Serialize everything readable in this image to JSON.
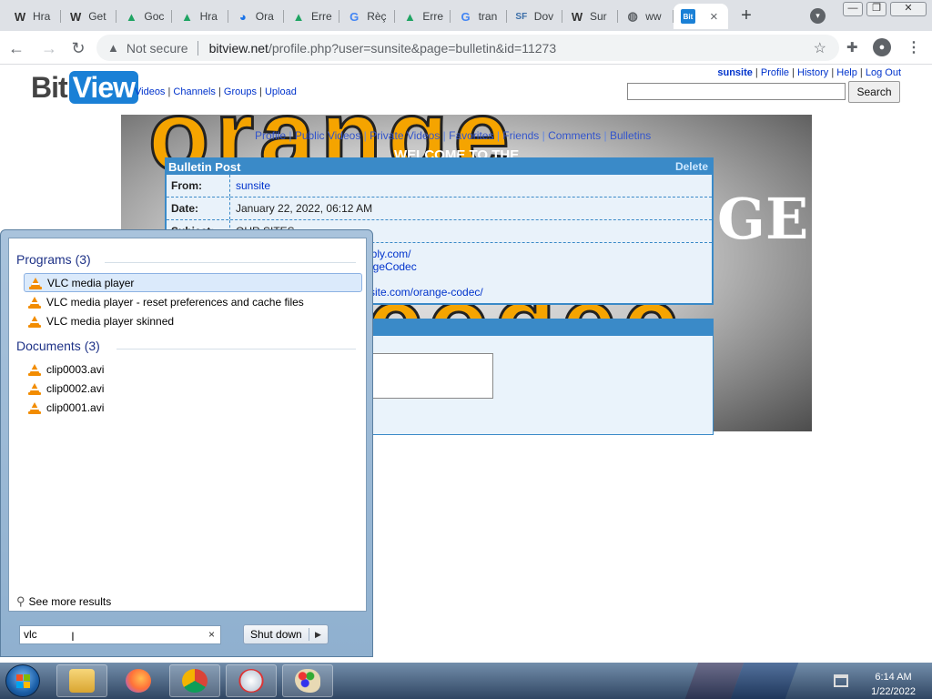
{
  "browser": {
    "tabs": [
      {
        "icon": "W",
        "label": "Hra",
        "color": "#333333"
      },
      {
        "icon": "W",
        "label": "Get",
        "color": "#333333"
      },
      {
        "icon": "▲",
        "label": "Goc",
        "color": "#1fa463"
      },
      {
        "icon": "▲",
        "label": "Hra",
        "color": "#1fa463"
      },
      {
        "icon": "◕",
        "label": "Ora",
        "color": "#1a73e8"
      },
      {
        "icon": "▲",
        "label": "Erre",
        "color": "#1fa463"
      },
      {
        "icon": "G",
        "label": "Rèç",
        "color": "#4285f4"
      },
      {
        "icon": "▲",
        "label": "Erre",
        "color": "#1fa463"
      },
      {
        "icon": "G",
        "label": "tran",
        "color": "#4285f4"
      },
      {
        "icon": "SF",
        "label": "Dov",
        "color": "#3b6ea8"
      },
      {
        "icon": "W",
        "label": "Sur",
        "color": "#333333"
      },
      {
        "icon": "◍",
        "label": "ww",
        "color": "#5f6368"
      }
    ],
    "active_tab": {
      "icon": "Bit",
      "close": "×"
    },
    "new_tab": "+",
    "address": {
      "security_icon": "▲",
      "security": "Not secure",
      "domain": "bitview.net",
      "path": "/profile.php?user=sunsite&page=bulletin&id=11273"
    },
    "window_controls": [
      "—",
      "❐",
      "✕"
    ]
  },
  "site": {
    "logo_bit": "Bit",
    "logo_view": "View",
    "nav": [
      "Videos",
      "Channels",
      "Groups",
      "Upload"
    ],
    "user_links": [
      "sunsite",
      "Profile",
      "History",
      "Help",
      "Log Out"
    ],
    "search_button": "Search",
    "profile_tabs": [
      "Profile",
      "Public Videos",
      "Private Videos",
      "Favorites",
      "Friends",
      "Comments",
      "Bulletins"
    ],
    "banner_welcome": "WELCOME TO THE",
    "banner_word1": "orange",
    "banner_word2": "codec",
    "banner_ge": "GE",
    "bulletin": {
      "title": "Bulletin Post",
      "delete": "Delete",
      "from_label": "From:",
      "from_value": "sunsite",
      "date_label": "Date:",
      "date_value": "January 22, 2022, 06:12 AM",
      "subject_label": "Subject:",
      "subject_value": "OUR SITES",
      "body_line1": "ebly.com/",
      "body_line2": "ngeCodec",
      "body_line3": "xsite.com/orange-codec/"
    }
  },
  "start_menu": {
    "programs_header": "Programs (3)",
    "programs": [
      "VLC media player",
      "VLC media player - reset preferences and cache files",
      "VLC media player skinned"
    ],
    "documents_header": "Documents (3)",
    "documents": [
      "clip0003.avi",
      "clip0002.avi",
      "clip0001.avi"
    ],
    "see_more": "See more results",
    "search_value": "vlc",
    "search_clear": "×",
    "shutdown_label": "Shut down",
    "shutdown_arrow": "▶"
  },
  "taskbar": {
    "time": "6:14 AM",
    "date": "1/22/2022"
  }
}
